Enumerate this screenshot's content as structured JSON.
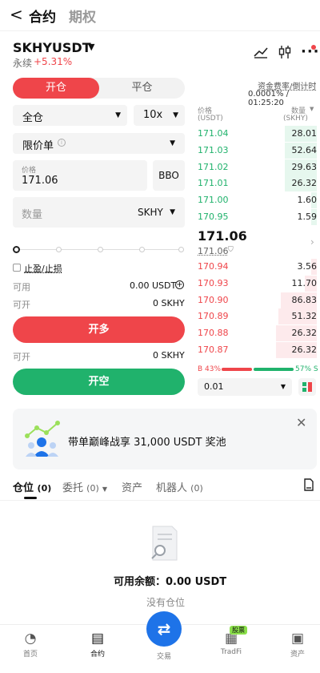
{
  "nav": {
    "back": "<",
    "tab_contract": "合约",
    "tab_options": "期权"
  },
  "ticker": {
    "symbol": "SKHYUSDT",
    "type": "永续",
    "change": "+5.31%"
  },
  "header_icons": [
    "chart-settings-icon",
    "candlestick-icon",
    "more-icon"
  ],
  "order": {
    "open_tab": "开仓",
    "close_tab": "平仓",
    "margin_mode": "全仓",
    "leverage": "10x",
    "order_type": "限价单",
    "price_label": "价格",
    "price_value": "171.06",
    "bbo": "BBO",
    "qty_placeholder": "数量",
    "qty_unit": "SKHY",
    "tpsl": "止盈/止损",
    "available_label": "可用",
    "available_value": "0.00 USDT",
    "open_long_max_label": "可开",
    "open_long_max": "0 SKHY",
    "open_long": "开多",
    "open_short_max_label": "可开",
    "open_short_max": "0 SKHY",
    "open_short": "开空"
  },
  "orderbook": {
    "funding_label": "资金费率/倒计时",
    "funding_value": "0.0001% / 01:25:20",
    "price_header": "价格",
    "price_unit": "(USDT)",
    "qty_header": "数量",
    "qty_unit": "(SKHY)",
    "asks": [
      {
        "price": "171.04",
        "qty": "28.01",
        "depth": 0.27
      },
      {
        "price": "171.03",
        "qty": "52.64",
        "depth": 0.27
      },
      {
        "price": "171.02",
        "qty": "29.63",
        "depth": 0.27
      },
      {
        "price": "171.01",
        "qty": "26.32",
        "depth": 0.27
      },
      {
        "price": "171.00",
        "qty": "1.60",
        "depth": 0.05
      },
      {
        "price": "170.95",
        "qty": "1.59",
        "depth": 0.05
      }
    ],
    "last_price": "171.06",
    "mark_price": "171.06",
    "bids": [
      {
        "price": "170.94",
        "qty": "3.56",
        "depth": 0.05
      },
      {
        "price": "170.93",
        "qty": "11.70",
        "depth": 0.1
      },
      {
        "price": "170.90",
        "qty": "86.83",
        "depth": 0.3
      },
      {
        "price": "170.89",
        "qty": "51.32",
        "depth": 0.32
      },
      {
        "price": "170.88",
        "qty": "26.32",
        "depth": 0.34
      },
      {
        "price": "170.87",
        "qty": "26.32",
        "depth": 0.34
      }
    ],
    "buy_ratio": "B 43%",
    "sell_ratio": "57% S",
    "buy_fraction": 0.43,
    "precision": "0.01"
  },
  "banner": {
    "text": "带单巅峰战享 31,000 USDT 奖池"
  },
  "tabs": {
    "positions": "仓位",
    "positions_count": "(0)",
    "orders": "委托",
    "orders_count": "(0)",
    "assets": "资产",
    "bots": "机器人",
    "bots_count": "(0)"
  },
  "empty": {
    "balance": "可用余额：0.00 USDT",
    "no_position": "没有仓位"
  },
  "bottom_nav": {
    "home": "首页",
    "contract": "合约",
    "trade": "交易",
    "tradfi": "TradFi",
    "tradfi_badge": "股票",
    "assets": "资产"
  },
  "colors": {
    "buy": "#20b26c",
    "sell": "#ef454a"
  }
}
